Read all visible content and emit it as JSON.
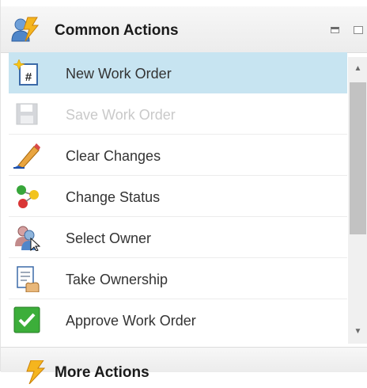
{
  "panel": {
    "title": "Common Actions",
    "title_icon": "people-lightning-icon",
    "minimize_icon": "minimize-icon",
    "maximize_icon": "maximize-icon"
  },
  "actions": [
    {
      "label": "New Work Order",
      "icon": "new-document-star-icon",
      "selected": true,
      "disabled": false
    },
    {
      "label": "Save Work Order",
      "icon": "floppy-disk-icon",
      "selected": false,
      "disabled": true
    },
    {
      "label": "Clear Changes",
      "icon": "eraser-pencil-icon",
      "selected": false,
      "disabled": false
    },
    {
      "label": "Change Status",
      "icon": "status-balls-icon",
      "selected": false,
      "disabled": false
    },
    {
      "label": "Select Owner",
      "icon": "users-cursor-icon",
      "selected": false,
      "disabled": false
    },
    {
      "label": "Take Ownership",
      "icon": "document-hand-icon",
      "selected": false,
      "disabled": false
    },
    {
      "label": "Approve Work Order",
      "icon": "green-checkmark-icon",
      "selected": false,
      "disabled": false
    }
  ],
  "scrollbar": {
    "up_glyph": "▲",
    "down_glyph": "▼"
  },
  "next_panel": {
    "title": "More Actions",
    "title_icon": "lightning-icon"
  },
  "colors": {
    "selected_row": "#c7e4f1",
    "disabled_text": "#c9c9c9",
    "approve_green": "#3cae3a"
  }
}
